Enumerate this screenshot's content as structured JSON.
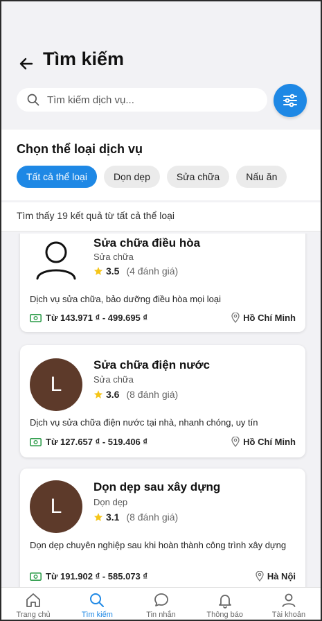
{
  "header": {
    "title": "Tìm kiếm",
    "search_placeholder": "Tìm kiếm dịch vụ..."
  },
  "categories": {
    "title": "Chọn thể loại dịch vụ",
    "chips": [
      {
        "label": "Tất cả thể loại",
        "active": true
      },
      {
        "label": "Dọn dẹp",
        "active": false
      },
      {
        "label": "Sửa chữa",
        "active": false
      },
      {
        "label": "Nấu ăn",
        "active": false
      }
    ]
  },
  "results": {
    "summary": "Tìm thấy 19 kết quả từ tất cả thể loại"
  },
  "services": [
    {
      "name": "Sửa chữa điều hòa",
      "category": "Sửa chữa",
      "rating": "3.5",
      "reviews": "(4 đánh giá)",
      "description": "Dịch vụ sửa chữa, bảo dưỡng điều hòa mọi loại",
      "price": "Từ 143.971 ₫ - 499.695 ₫",
      "location": "Hồ Chí Minh",
      "avatar": "person-icon"
    },
    {
      "name": "Sửa chữa điện nước",
      "category": "Sửa chữa",
      "rating": "3.6",
      "reviews": "(8 đánh giá)",
      "description": "Dịch vụ sửa chữa điện nước tại nhà, nhanh chóng, uy tín",
      "price": "Từ 127.657 ₫ - 519.406 ₫",
      "location": "Hồ Chí Minh",
      "avatar": "L"
    },
    {
      "name": "Dọn dẹp sau xây dựng",
      "category": "Dọn dẹp",
      "rating": "3.1",
      "reviews": "(8 đánh giá)",
      "description": "Dọn dẹp chuyên nghiệp sau khi hoàn thành công trình xây dựng",
      "price": "Từ 191.902 ₫ - 585.073 ₫",
      "location": "Hà Nội",
      "avatar": "L"
    }
  ],
  "nav": [
    {
      "label": "Trang chủ",
      "icon": "home-icon"
    },
    {
      "label": "Tìm kiếm",
      "icon": "search-icon",
      "active": true
    },
    {
      "label": "Tin nhắn",
      "icon": "chat-icon"
    },
    {
      "label": "Thông báo",
      "icon": "bell-icon"
    },
    {
      "label": "Tài khoản",
      "icon": "user-icon"
    }
  ],
  "colors": {
    "accent": "#1e88e5",
    "avatar_bg": "#5d3a2a",
    "star": "#f5c518",
    "price_icon": "#2e9d4b"
  }
}
